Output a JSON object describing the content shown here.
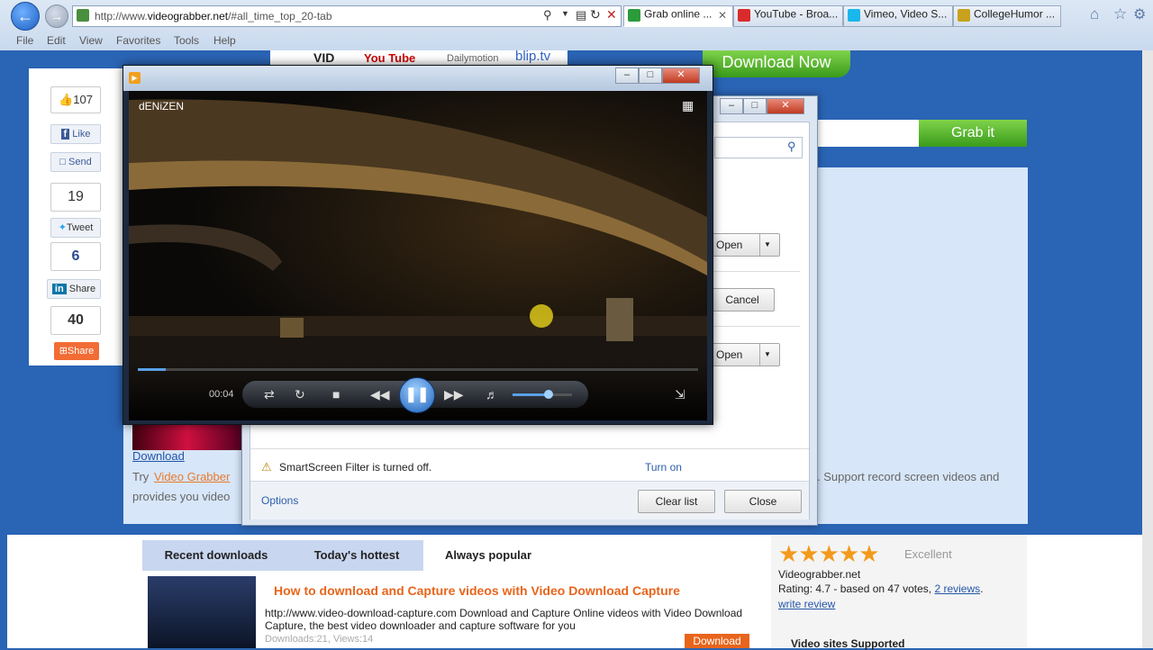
{
  "browser": {
    "address": {
      "prefix": "http://www.",
      "domain": "videograbber.net",
      "path": "/#all_time_top_20-tab"
    },
    "tabs": [
      {
        "label": "Grab online ...",
        "color": "#2c9b3c",
        "active": true
      },
      {
        "label": "YouTube - Broa...",
        "color": "#d92b2b"
      },
      {
        "label": "Vimeo, Video S...",
        "color": "#1ab7ea"
      },
      {
        "label": "CollegeHumor ...",
        "color": "#c8a21c"
      }
    ],
    "menu": [
      "File",
      "Edit",
      "View",
      "Favorites",
      "Tools",
      "Help"
    ]
  },
  "site": {
    "logos": [
      "VID",
      "You Tube",
      "Dailymotion",
      "blip.tv"
    ],
    "download_now": "Download Now",
    "grab_it": "Grab it",
    "social": {
      "fb_count": "107",
      "fb_like": "Like",
      "fb_send": "Send",
      "tw_count": "19",
      "tw_tweet": "Tweet",
      "in_count": "6",
      "in_share": "Share",
      "share_count": "40",
      "share_label": "Share"
    },
    "download_link": "Download",
    "try_prefix": "Try",
    "try_link": "Video Grabber",
    "provides": "provides you video",
    "support_text": ". Support record screen videos and",
    "tabs": [
      "Recent downloads",
      "Today's hottest",
      "Always popular"
    ],
    "article": {
      "title": "How to download and Capture videos with Video Download Capture",
      "desc": "http://www.video-download-capture.com Download and Capture Online videos with Video Download Capture, the best video downloader and capture software for you",
      "stats": "Downloads:21, Views:14",
      "button": "Download"
    },
    "rating": {
      "stars": 4.7,
      "label": "Excellent",
      "site": "Videograbber.net",
      "text": "Rating: 4.7 - based on 47 votes,",
      "reviews": "2 reviews",
      "write": "write review"
    },
    "sites_supported": "Video sites Supported"
  },
  "download_manager": {
    "open1": "Open",
    "cancel": "Cancel",
    "open2": "Open",
    "smartscreen": "SmartScreen Filter is turned off.",
    "turn_on": "Turn on",
    "options": "Options",
    "clear_list": "Clear list",
    "close": "Close"
  },
  "player": {
    "title": "dENiZEN",
    "time": "00:04",
    "progress": 0.05,
    "volume": 0.6
  }
}
